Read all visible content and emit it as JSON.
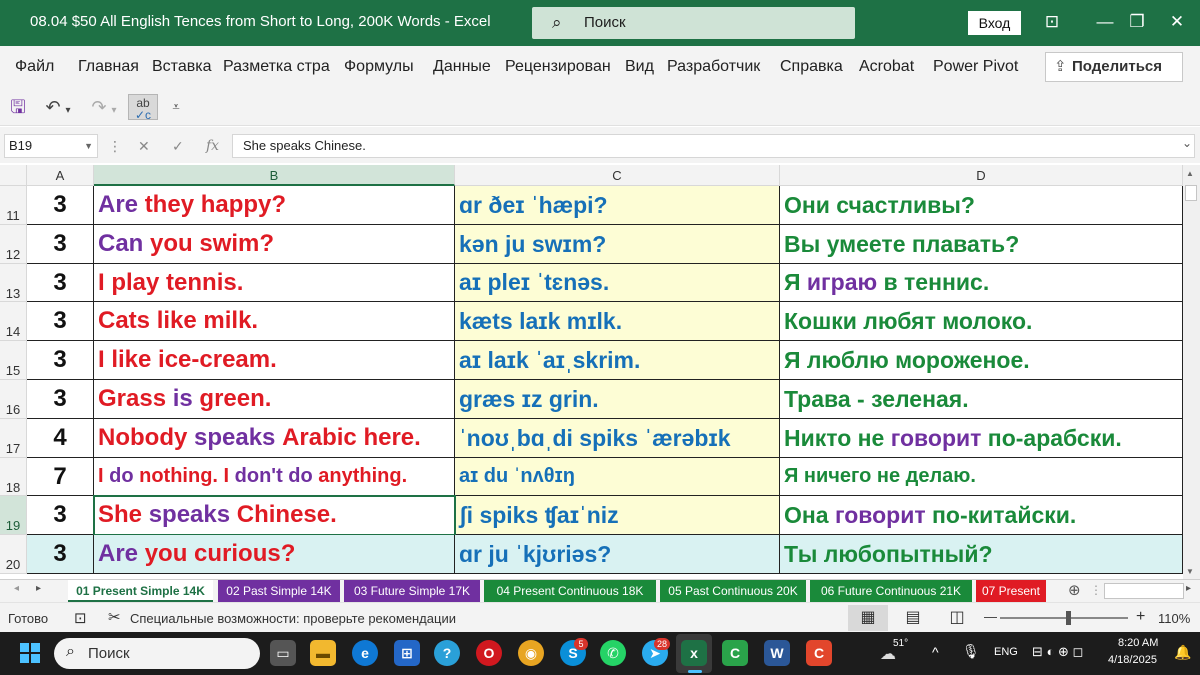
{
  "window": {
    "title": "08.04 $50 All English Tences from Short to Long,  200K Words  -  Excel",
    "search_placeholder": "Поиск",
    "signin_label": "Вход"
  },
  "ribbon": {
    "tabs": [
      "Файл",
      "Главная",
      "Вставка",
      "Разметка стра",
      "Формулы",
      "Данные",
      "Рецензирован",
      "Вид",
      "Разработчик",
      "Справка",
      "Acrobat",
      "Power Pivot"
    ],
    "share_label": "Поделиться"
  },
  "formula_bar": {
    "name_box": "B19",
    "fx": "fx",
    "content": "She speaks Chinese."
  },
  "columns": [
    "A",
    "B",
    "C",
    "D"
  ],
  "rows": [
    {
      "num": "11",
      "a": "3",
      "b": [
        [
          "Are ",
          "#7030a0"
        ],
        [
          "they happy?",
          "#e01b24"
        ]
      ],
      "c": "ɑr ðeɪ ˈhæpi?",
      "d": [
        [
          "Они счастливы?",
          "#1a8a3a"
        ]
      ]
    },
    {
      "num": "12",
      "a": "3",
      "b": [
        [
          "Can ",
          "#7030a0"
        ],
        [
          "you swim?",
          "#e01b24"
        ]
      ],
      "c": "kən ju swɪm?",
      "d": [
        [
          "Вы умеете плавать?",
          "#1a8a3a"
        ]
      ]
    },
    {
      "num": "13",
      "a": "3",
      "b": [
        [
          "I play tennis.",
          "#e01b24"
        ]
      ],
      "c": "aɪ pleɪ ˈtɛnəs.",
      "d": [
        [
          "Я ",
          "#1a8a3a"
        ],
        [
          "играю ",
          "#7030a0"
        ],
        [
          "в теннис.",
          "#1a8a3a"
        ]
      ]
    },
    {
      "num": "14",
      "a": "3",
      "b": [
        [
          "Cats like milk.",
          "#e01b24"
        ]
      ],
      "c": "kæts laɪk mɪlk.",
      "d": [
        [
          "Кошки любят молоко.",
          "#1a8a3a"
        ]
      ]
    },
    {
      "num": "15",
      "a": "3",
      "b": [
        [
          "I like ice-cream.",
          "#e01b24"
        ]
      ],
      "c": "aɪ laɪk ˈaɪˌskrim.",
      "d": [
        [
          "Я люблю мороженое.",
          "#1a8a3a"
        ]
      ]
    },
    {
      "num": "16",
      "a": "3",
      "b": [
        [
          "Grass ",
          "#e01b24"
        ],
        [
          "is ",
          "#7030a0"
        ],
        [
          "green.",
          "#e01b24"
        ]
      ],
      "c": "græs ɪz grin.",
      "d": [
        [
          "Трава - зеленая.",
          "#1a8a3a"
        ]
      ]
    },
    {
      "num": "17",
      "a": "4",
      "b": [
        [
          "Nobody ",
          "#e01b24"
        ],
        [
          "speaks ",
          "#7030a0"
        ],
        [
          "Arabic here.",
          "#e01b24"
        ]
      ],
      "c": "ˈnoʊˌbɑˌdi spiks ˈærəbɪk",
      "d": [
        [
          "Никто не ",
          "#1a8a3a"
        ],
        [
          "говорит ",
          "#7030a0"
        ],
        [
          "по-арабски.",
          "#1a8a3a"
        ]
      ]
    },
    {
      "num": "18",
      "a": "7",
      "small": true,
      "b": [
        [
          "I ",
          "#e01b24"
        ],
        [
          "do ",
          "#7030a0"
        ],
        [
          "nothing. I ",
          "#e01b24"
        ],
        [
          "don't do ",
          "#7030a0"
        ],
        [
          "anything.",
          "#e01b24"
        ]
      ],
      "c": "aɪ du ˈnʌθɪŋ",
      "d": [
        [
          "Я ничего не делаю.",
          "#1a8a3a"
        ]
      ]
    },
    {
      "num": "19",
      "a": "3",
      "b": [
        [
          "She ",
          "#e01b24"
        ],
        [
          "speaks ",
          "#7030a0"
        ],
        [
          "Chinese.",
          "#e01b24"
        ]
      ],
      "c": "ʃi spiks ʧaɪˈniz",
      "d": [
        [
          "Она ",
          "#1a8a3a"
        ],
        [
          "говорит ",
          "#7030a0"
        ],
        [
          "по-китайски.",
          "#1a8a3a"
        ]
      ]
    },
    {
      "num": "20",
      "a": "3",
      "b": [
        [
          "Are ",
          "#7030a0"
        ],
        [
          "you curious?",
          "#e01b24"
        ]
      ],
      "c": "ɑr ju ˈkjʊriəs?",
      "d": [
        [
          "Ты любопытный?",
          "#1a8a3a"
        ]
      ]
    }
  ],
  "sheet_tabs": [
    {
      "label": "01 Present Simple 14K",
      "color": "#ffffff",
      "text": "#1e7145",
      "active": true
    },
    {
      "label": "02 Past Simple 14K",
      "color": "#7030a0",
      "text": "#ffffff"
    },
    {
      "label": "03 Future Simple 17K",
      "color": "#7030a0",
      "text": "#ffffff"
    },
    {
      "label": "04 Present Continuous 18K",
      "color": "#1a8a3a",
      "text": "#ffffff"
    },
    {
      "label": "05 Past Continuous 20K",
      "color": "#1a8a3a",
      "text": "#ffffff"
    },
    {
      "label": "06 Future Continuous 21K",
      "color": "#1a8a3a",
      "text": "#ffffff"
    },
    {
      "label": "07 Present",
      "color": "#e01b24",
      "text": "#ffffff"
    }
  ],
  "status": {
    "ready": "Готово",
    "accessibility": "Специальные возможности: проверьте рекомендации",
    "zoom": "110%"
  },
  "taskbar": {
    "search_placeholder": "Поиск",
    "weather": "51°",
    "lang": "ENG",
    "time": "8:20 AM",
    "date": "4/18/2025",
    "badges": {
      "skype": "5",
      "telegram": "28"
    }
  }
}
